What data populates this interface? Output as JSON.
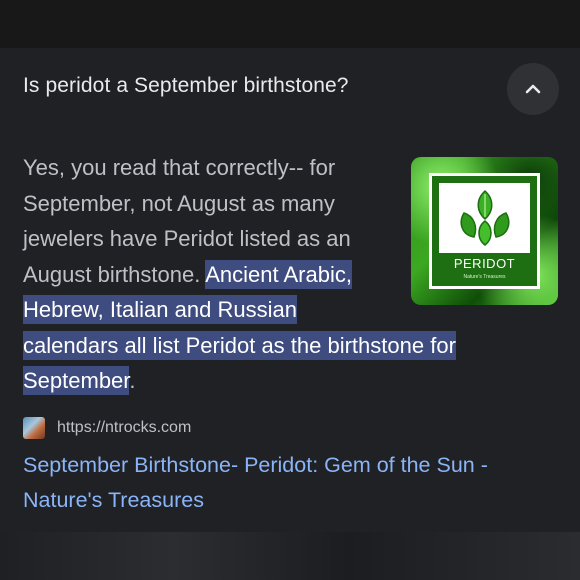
{
  "question": "Is peridot a September birthstone?",
  "answer": {
    "plain": "Yes, you read that correctly-- for September, not August as many jewelers have Peridot listed as an August birthstone. ",
    "highlight_part1": "Ancient Arabic, Hebrew, Italian and Russian",
    "highlight_part2": "calendars all list Peridot as the birthstone for September",
    "end": "."
  },
  "image": {
    "label": "PERIDOT",
    "sublabel": "Nature's Treasures"
  },
  "source": {
    "url": "https://ntrocks.com",
    "title": "September Birthstone- Peridot: Gem of the Sun - Nature's Treasures"
  },
  "colors": {
    "background": "#202124",
    "highlight": "#3f4c7f",
    "link": "#8ab4f8",
    "text": "#bdc1c6",
    "title": "#e8eaed"
  },
  "icons": {
    "collapse": "chevron-up-icon"
  }
}
